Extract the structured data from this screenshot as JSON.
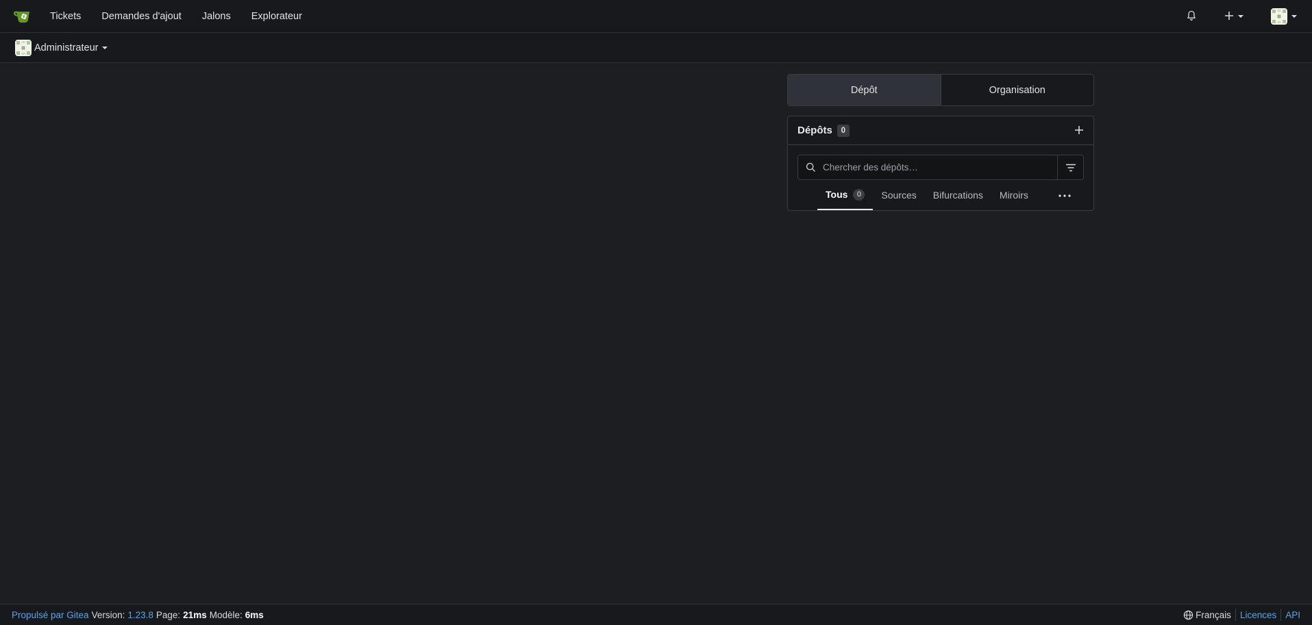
{
  "navbar": {
    "items": [
      {
        "label": "Tickets"
      },
      {
        "label": "Demandes d'ajout"
      },
      {
        "label": "Jalons"
      },
      {
        "label": "Explorateur"
      }
    ]
  },
  "context": {
    "label": "Administrateur"
  },
  "switcher": {
    "repo_label": "Dépôt",
    "org_label": "Organisation"
  },
  "repos": {
    "title": "Dépôts",
    "count": "0",
    "search_placeholder": "Chercher des dépôts…",
    "tabs": [
      {
        "label": "Tous",
        "count": "0"
      },
      {
        "label": "Sources"
      },
      {
        "label": "Bifurcations"
      },
      {
        "label": "Miroirs"
      }
    ]
  },
  "footer": {
    "powered_by": "Propulsé par Gitea",
    "version_label": "Version:",
    "version": "1.23.8",
    "page_label": "Page:",
    "page_time": "21ms",
    "template_label": "Modèle:",
    "template_time": "6ms",
    "language": "Français",
    "licenses": "Licences",
    "api": "API"
  },
  "colors": {
    "background": "#1c1e22",
    "bar": "#17191c",
    "link": "#5ba5e6",
    "logo_green": "#609926"
  },
  "icons": [
    "gitea-logo-icon",
    "bell-icon",
    "plus-icon",
    "avatar",
    "search-icon",
    "filter-icon",
    "more-icon",
    "globe-icon"
  ]
}
